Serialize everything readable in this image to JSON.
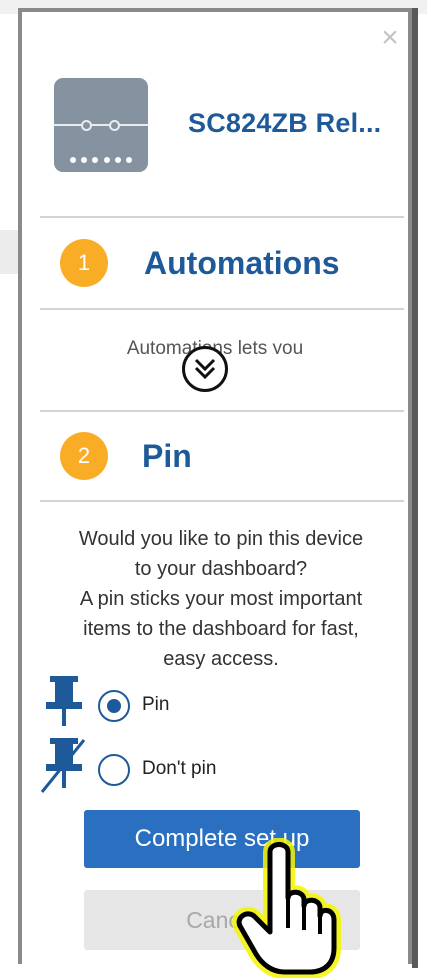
{
  "device": {
    "name": "SC824ZB Rel..."
  },
  "steps": [
    {
      "number": "1",
      "title": "Automations",
      "preview_text": "Automations lets you"
    },
    {
      "number": "2",
      "title": "Pin"
    }
  ],
  "pin_section": {
    "question_lines": [
      "Would you like to pin this device",
      "to your dashboard?",
      "A pin sticks your most important",
      "items to the dashboard for fast,",
      "easy access."
    ],
    "options": [
      {
        "label": "Pin",
        "selected": true
      },
      {
        "label": "Don't pin",
        "selected": false
      }
    ]
  },
  "buttons": {
    "complete_label": "Complete set up",
    "cancel_label": "Cancel"
  },
  "colors": {
    "accent_blue": "#1e5a9a",
    "button_blue": "#2a6fc0",
    "step_badge": "#f9ad27",
    "hand_highlight": "#f4f400"
  },
  "icons": [
    "close-icon",
    "device-icon",
    "expand-chevrons-icon",
    "pin-icon",
    "unpin-icon",
    "pointer-hand-icon"
  ]
}
